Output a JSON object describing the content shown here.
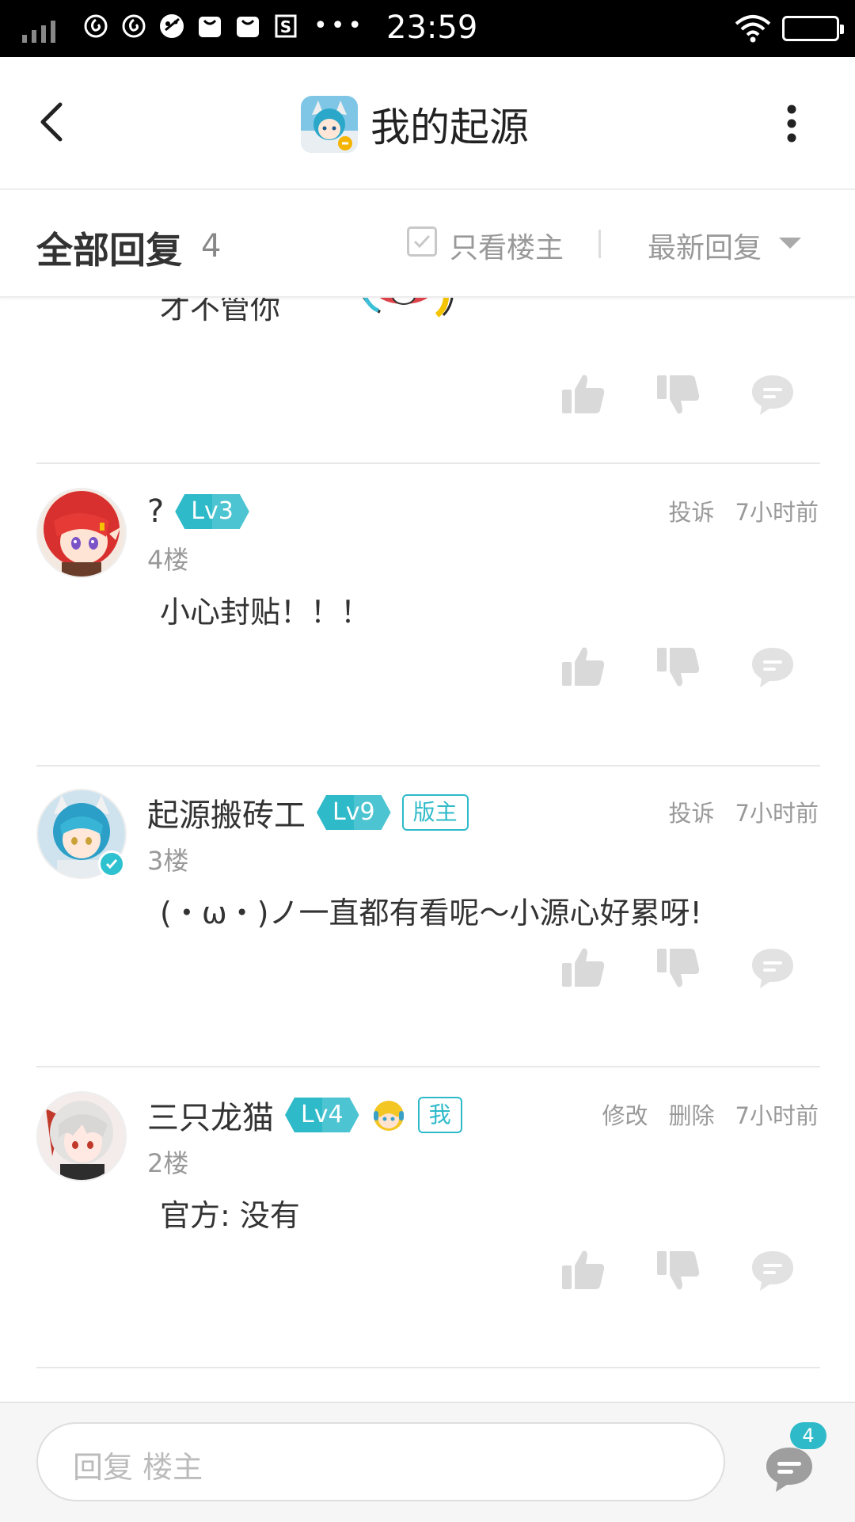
{
  "status_bar": {
    "time": "23:59",
    "overflow": "•••",
    "icons": [
      "signal-icon",
      "netease-icon",
      "netease-icon",
      "game-icon",
      "bag-icon",
      "bag-icon",
      "s-icon",
      "wifi-icon",
      "battery-icon"
    ]
  },
  "header": {
    "title": "我的起源",
    "back_icon": "back-arrow-icon",
    "more_icon": "more-vertical-icon"
  },
  "replies_bar": {
    "title": "全部回复",
    "count": "4",
    "only_op_label": "只看楼主",
    "sort_label": "最新回复"
  },
  "partial_post": {
    "text": "才不管你"
  },
  "posts": [
    {
      "username": "?",
      "level": "Lv3",
      "floor": "4楼",
      "actions": [
        "投诉"
      ],
      "time": "7小时前",
      "content": "小心封贴！！！"
    },
    {
      "username": "起源搬砖工",
      "level": "Lv9",
      "tag": "版主",
      "floor": "3楼",
      "actions": [
        "投诉"
      ],
      "time": "7小时前",
      "content": "(・ω・)ノ一直都有看呢～小源心好累呀!"
    },
    {
      "username": "三只龙猫",
      "level": "Lv4",
      "tag": "我",
      "floor": "2楼",
      "actions": [
        "修改",
        "删除"
      ],
      "time": "7小时前",
      "content": "官方: 没有"
    }
  ],
  "bottom_bar": {
    "placeholder": "回复  楼主",
    "comment_count": "4"
  },
  "colors": {
    "accent": "#2ebac9",
    "icon_gray": "#d9d9d9",
    "text_gray": "#999999"
  }
}
